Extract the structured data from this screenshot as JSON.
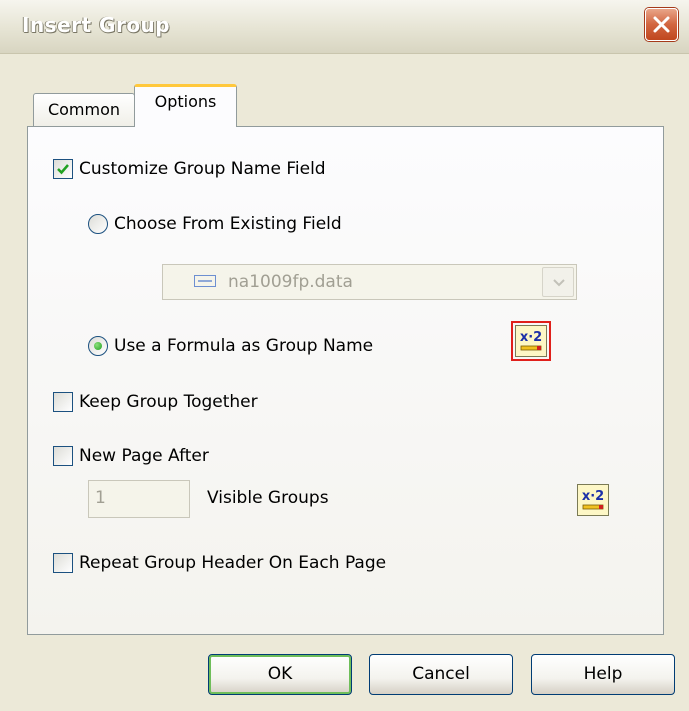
{
  "window": {
    "title": "Insert Group"
  },
  "tabs": [
    {
      "label": "Common",
      "active": false
    },
    {
      "label": "Options",
      "active": true
    }
  ],
  "options": {
    "customize_group_name": {
      "label": "Customize Group Name Field",
      "checked": true
    },
    "choose_existing": {
      "label": "Choose From Existing Field",
      "selected": false
    },
    "existing_field_select": {
      "value": "na1009fp.data",
      "enabled": false
    },
    "use_formula": {
      "label": "Use a Formula as Group Name",
      "selected": true
    },
    "formula_icon_label": "x·2",
    "keep_together": {
      "label": "Keep Group Together",
      "checked": false
    },
    "new_page_after": {
      "label": "New Page After",
      "checked": false
    },
    "visible_groups": {
      "value": "1",
      "label": "Visible Groups",
      "enabled": false
    },
    "repeat_header": {
      "label": "Repeat Group Header On Each Page",
      "checked": false
    }
  },
  "buttons": {
    "ok": "OK",
    "cancel": "Cancel",
    "help": "Help"
  },
  "colors": {
    "dialog_bg": "#ece9d8",
    "tab_highlight": "#ffc83c",
    "checkbox_border": "#1c5180",
    "check_mark": "#21a121",
    "close_button": "#d26640",
    "focus_outline": "#e0201b",
    "ok_focus": "#6fbe5a"
  }
}
